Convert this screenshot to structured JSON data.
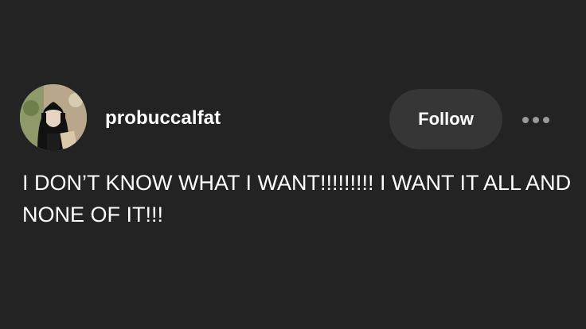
{
  "post": {
    "username": "probuccalfat",
    "follow_label": "Follow",
    "more_icon": "more-horizontal-icon",
    "text": "I DON’T KNOW WHAT I WANT!!!!!!!!! I WANT IT ALL AND NONE OF IT!!!"
  },
  "colors": {
    "background": "#232323",
    "follow_button_bg": "#363636",
    "text": "#ffffff",
    "more_dots": "#9a9a9a"
  }
}
